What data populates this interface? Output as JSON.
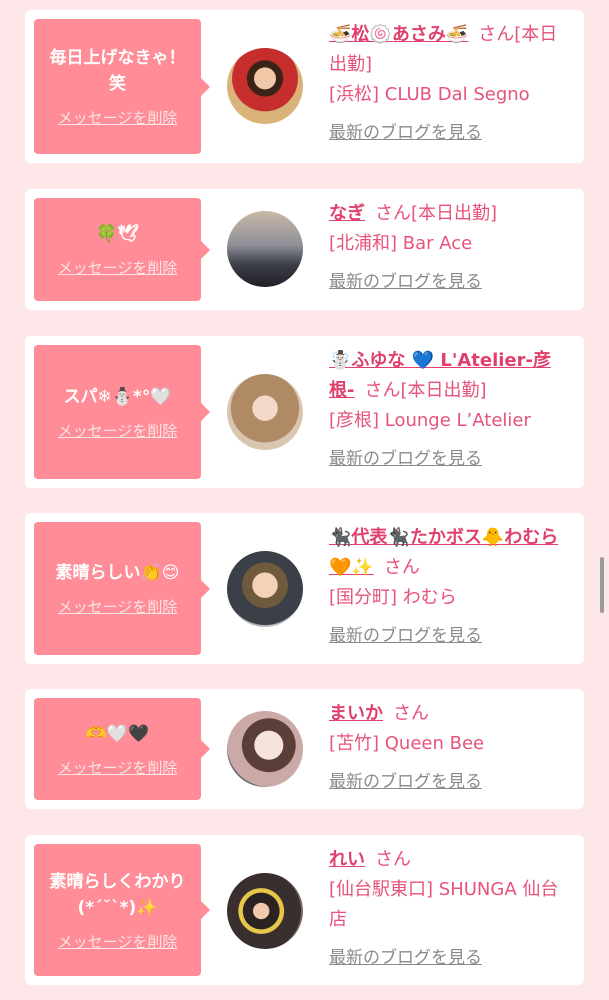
{
  "cards": [
    {
      "message": "毎日上げなきゃ！笑",
      "delete_label": "メッセージを削除",
      "name": "🍜松🍥あさみ🍜",
      "suffix": "さん[本日出勤]",
      "shop": "[浜松] CLUB Dal Segno",
      "blog_label": "最新のブログを見る"
    },
    {
      "message": "🍀🕊",
      "delete_label": "メッセージを削除",
      "name": "なぎ",
      "suffix": "さん[本日出勤]",
      "shop": "[北浦和] Bar Ace",
      "blog_label": "最新のブログを見る"
    },
    {
      "message": "スパ❄︎⛄️*°🤍",
      "delete_label": "メッセージを削除",
      "name": "☃️ふゆな 💙 L'Atelier-彦根-",
      "suffix": "さん[本日出勤]",
      "shop": "[彦根] Lounge L’Atelier",
      "blog_label": "最新のブログを見る"
    },
    {
      "message": "素晴らしい👏😊",
      "delete_label": "メッセージを削除",
      "name": "🐈‍⬛代表🐈‍⬛たかボス🐥わむら🧡✨",
      "suffix": "さん",
      "shop": "[国分町] わむら",
      "blog_label": "最新のブログを見る"
    },
    {
      "message": "🫶🤍🖤",
      "delete_label": "メッセージを削除",
      "name": "まいか",
      "suffix": "さん",
      "shop": "[苫竹] Queen Bee",
      "blog_label": "最新のブログを見る"
    },
    {
      "message": "素晴らしくわかり(*´˘`*)✨",
      "delete_label": "メッセージを削除",
      "name": "れい",
      "suffix": "さん",
      "shop": "[仙台駅東口] SHUNGA 仙台店",
      "blog_label": "最新のブログを見る"
    }
  ],
  "colors": {
    "background": "#fde7e9",
    "bubble": "#ff8c96",
    "name": "#e0406c",
    "link_gray": "#8a8a8a"
  }
}
